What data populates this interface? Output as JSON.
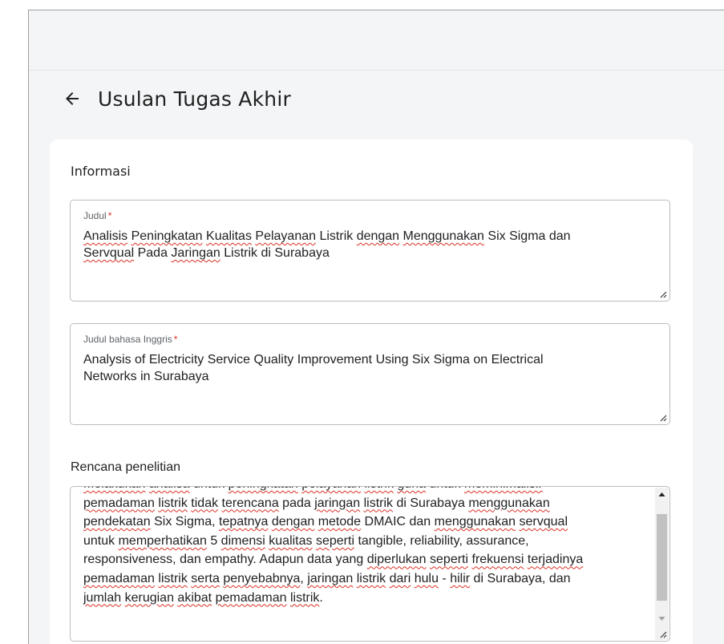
{
  "header": {
    "title": "Usulan Tugas Akhir",
    "back_icon": "arrow-left-icon"
  },
  "card": {
    "section_title": "Informasi",
    "judul": {
      "label": "Judul",
      "required_mark": "*",
      "line1": [
        {
          "t": "Analisis",
          "sp": true
        },
        {
          "t": " "
        },
        {
          "t": "Peningkatan",
          "sp": true
        },
        {
          "t": " "
        },
        {
          "t": "Kualitas",
          "sp": true
        },
        {
          "t": " "
        },
        {
          "t": "Pelayanan",
          "sp": true
        },
        {
          "t": " Listrik "
        },
        {
          "t": "dengan",
          "sp": true
        },
        {
          "t": " "
        },
        {
          "t": "Menggunakan",
          "sp": true
        },
        {
          "t": " Six Sigma dan"
        }
      ],
      "line2": [
        {
          "t": "Servqual",
          "sp": true
        },
        {
          "t": " Pada "
        },
        {
          "t": "Jaringan",
          "sp": true
        },
        {
          "t": " Listrik di Surabaya"
        }
      ]
    },
    "judul_inggris": {
      "label": "Judul bahasa Inggris",
      "required_mark": "*",
      "line1": "Analysis of Electricity Service Quality Improvement Using Six Sigma on Electrical",
      "line2": "Networks in Surabaya"
    },
    "rencana": {
      "label": "Rencana penelitian",
      "lines": [
        [
          {
            "t": "Melakukan",
            "sp": true
          },
          {
            "t": " "
          },
          {
            "t": "analisa",
            "sp": true
          },
          {
            "t": " untuk "
          },
          {
            "t": "peningkatan",
            "sp": true
          },
          {
            "t": " "
          },
          {
            "t": "pelayanan",
            "sp": true
          },
          {
            "t": " "
          },
          {
            "t": "listrik",
            "sp": true
          },
          {
            "t": "  "
          },
          {
            "t": "guna",
            "sp": true
          },
          {
            "t": " untuk "
          },
          {
            "t": "meminimalisir",
            "sp": true
          }
        ],
        [
          {
            "t": "pemadaman",
            "sp": true
          },
          {
            "t": " "
          },
          {
            "t": "listrik",
            "sp": true
          },
          {
            "t": " "
          },
          {
            "t": "tidak",
            "sp": true
          },
          {
            "t": " "
          },
          {
            "t": "terencana",
            "sp": true
          },
          {
            "t": " pada "
          },
          {
            "t": "jaringan",
            "sp": true
          },
          {
            "t": " "
          },
          {
            "t": "listrik",
            "sp": true
          },
          {
            "t": " di Surabaya "
          },
          {
            "t": "menggunakan",
            "sp": true
          }
        ],
        [
          {
            "t": "pendekatan",
            "sp": true
          },
          {
            "t": " Six Sigma, "
          },
          {
            "t": "tepatnya",
            "sp": true
          },
          {
            "t": " "
          },
          {
            "t": "dengan",
            "sp": true
          },
          {
            "t": " "
          },
          {
            "t": "metode",
            "sp": true
          },
          {
            "t": " DMAIC dan "
          },
          {
            "t": "menggunakan",
            "sp": true
          },
          {
            "t": " "
          },
          {
            "t": "servqual",
            "sp": true
          }
        ],
        [
          {
            "t": "untuk "
          },
          {
            "t": "memperhatikan",
            "sp": true
          },
          {
            "t": " 5 "
          },
          {
            "t": "dimensi",
            "sp": true
          },
          {
            "t": " "
          },
          {
            "t": "kualitas",
            "sp": true
          },
          {
            "t": " "
          },
          {
            "t": "seperti",
            "sp": true
          },
          {
            "t": " tangible, reliability, assurance,"
          }
        ],
        [
          {
            "t": "responsiveness, dan empathy. Adapun data yang "
          },
          {
            "t": "diperlukan",
            "sp": true
          },
          {
            "t": " "
          },
          {
            "t": "seperti",
            "sp": true
          },
          {
            "t": " "
          },
          {
            "t": "frekuensi",
            "sp": true
          },
          {
            "t": " "
          },
          {
            "t": "terjadinya",
            "sp": true
          }
        ],
        [
          {
            "t": "pemadaman",
            "sp": true
          },
          {
            "t": " "
          },
          {
            "t": "listrik",
            "sp": true
          },
          {
            "t": " "
          },
          {
            "t": "serta",
            "sp": true
          },
          {
            "t": " "
          },
          {
            "t": "penyebabnya",
            "sp": true
          },
          {
            "t": ", "
          },
          {
            "t": "jaringan",
            "sp": true
          },
          {
            "t": " "
          },
          {
            "t": "listrik",
            "sp": true
          },
          {
            "t": " "
          },
          {
            "t": "dari",
            "sp": true
          },
          {
            "t": " "
          },
          {
            "t": "hulu",
            "sp": true
          },
          {
            "t": " - "
          },
          {
            "t": "hilir",
            "sp": true
          },
          {
            "t": " di Surabaya, dan"
          }
        ],
        [
          {
            "t": "jumlah",
            "sp": true
          },
          {
            "t": " "
          },
          {
            "t": "kerugian",
            "sp": true
          },
          {
            "t": " "
          },
          {
            "t": "akibat",
            "sp": true
          },
          {
            "t": " "
          },
          {
            "t": "pemadaman",
            "sp": true
          },
          {
            "t": " "
          },
          {
            "t": "listrik",
            "sp": true
          },
          {
            "t": "."
          }
        ]
      ]
    }
  },
  "colors": {
    "required": "#d93025",
    "spellcheck": "#d93025",
    "page_bg": "#f4f5f7",
    "card_bg": "#ffffff"
  }
}
